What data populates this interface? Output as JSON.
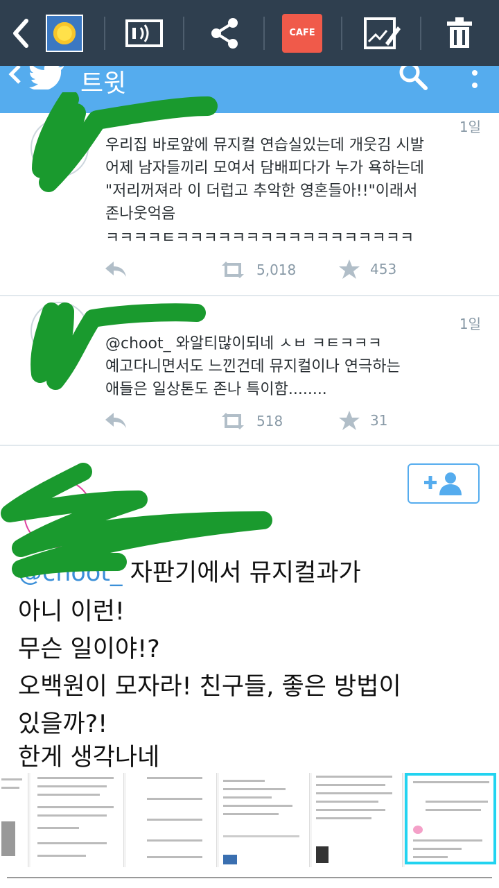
{
  "toolbar": {
    "icons": [
      "back-icon",
      "thumbnail",
      "cast-icon",
      "share-icon",
      "cafe-icon",
      "edit-icon",
      "delete-icon"
    ],
    "cafe_label": "CAFE",
    "bg_color": "#2f3f4f"
  },
  "header": {
    "title": "트윗",
    "bg_color": "#55acee"
  },
  "tweets": [
    {
      "time": "1일",
      "lines": [
        "우리집 바로앞에 뮤지컬 연습실있는데 개웃김 시발",
        "어제 남자들끼리 모여서 담배피다가 누가 욕하는데",
        "\"저리꺼져라 이 더럽고 추악한 영혼들아!!\"이래서",
        "존나웃억음",
        "ㅋㅋㅋㅋㅌㅋㅋㅋㅋㅋㅋㅋㅋㅋㅋㅋㅋㅋㅋㅋㅋㅋ"
      ],
      "retweets": "5,018",
      "favorites": "453"
    },
    {
      "time": "1일",
      "mention": "@choot_",
      "lines": [
        " 와알티많이되네 ㅅㅂ ㅋㅌㅋㅋㅋ",
        "예고다니면서도 느낀건데 뮤지컬이나 연극하는",
        "애들은 일상톤도 존나 특이함........"
      ],
      "retweets": "518",
      "favorites": "31"
    }
  ],
  "detail_tweet": {
    "mention": "@choot_",
    "lines": [
      " 자판기에서 뮤지컬과가",
      "아니 이런!",
      "무슨 일이야!?",
      "오백원이 모자라! 친구들, 좋은 방법이",
      "있을까?!",
      "한게 생각나네"
    ]
  },
  "accent_color": "#55acee",
  "highlight_color": "#22d3f0"
}
